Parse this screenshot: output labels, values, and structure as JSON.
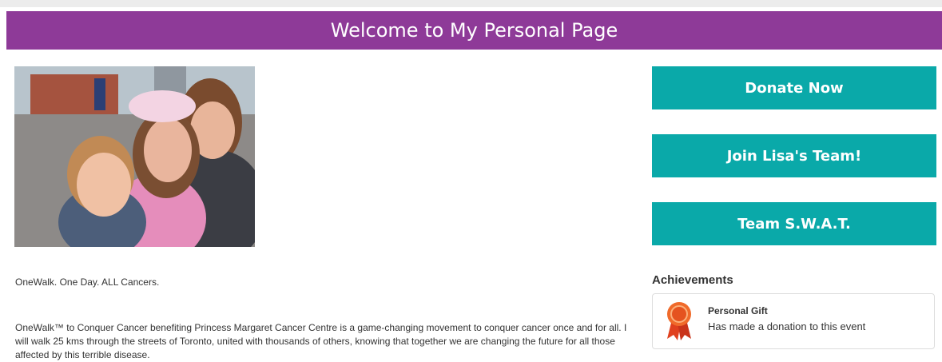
{
  "header": {
    "title": "Welcome to My Personal Page"
  },
  "sidebar": {
    "buttons": [
      {
        "label": "Donate Now"
      },
      {
        "label": "Join Lisa's Team!"
      },
      {
        "label": "Team S.W.A.T."
      }
    ],
    "achievements": {
      "title": "Achievements",
      "items": [
        {
          "name": "Personal Gift",
          "description": "Has made a donation to this event",
          "icon": "ribbon-award-icon"
        }
      ]
    }
  },
  "main": {
    "tagline": "OneWalk. One Day. ALL Cancers.",
    "story": "OneWalk™ to Conquer Cancer benefiting Princess Margaret Cancer Centre is a game-changing movement to conquer cancer once and for all.  I will walk 25 kms through the streets of Toronto, united with thousands of others, knowing that together we are changing the future for all those affected by this terrible disease."
  },
  "colors": {
    "header": "#8e3a98",
    "button": "#0aa9a9",
    "text": "#333333"
  }
}
